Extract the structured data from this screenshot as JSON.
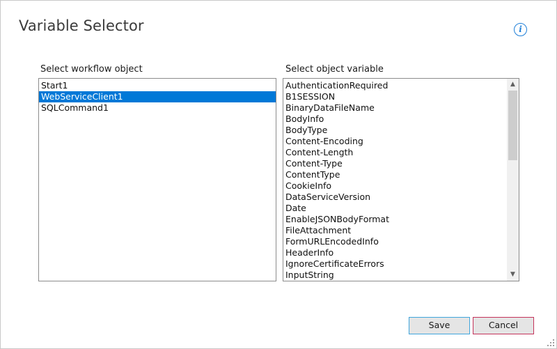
{
  "dialog": {
    "title": "Variable Selector",
    "info_icon": "info-icon",
    "accent_color": "#1ba1e2"
  },
  "left_panel": {
    "label": "Select workflow object",
    "items": [
      "Start1",
      "WebServiceClient1",
      "SQLCommand1"
    ],
    "selected": "WebServiceClient1"
  },
  "right_panel": {
    "label": "Select object variable",
    "items": [
      "AuthenticationRequired",
      "B1SESSION",
      "BinaryDataFileName",
      "BodyInfo",
      "BodyType",
      "Content-Encoding",
      "Content-Length",
      "Content-Type",
      "ContentType",
      "CookieInfo",
      "DataServiceVersion",
      "Date",
      "EnableJSONBodyFormat",
      "FileAttachment",
      "FormURLEncodedInfo",
      "HeaderInfo",
      "IgnoreCertificateErrors",
      "InputString"
    ],
    "scroll_up_icon": "chevron-up-icon",
    "scroll_down_icon": "chevron-down-icon"
  },
  "buttons": {
    "save_label": "Save",
    "cancel_label": "Cancel",
    "save_border_color": "#3fa5dc",
    "cancel_border_color": "#c4335a",
    "selection_color": "#0078d7"
  }
}
